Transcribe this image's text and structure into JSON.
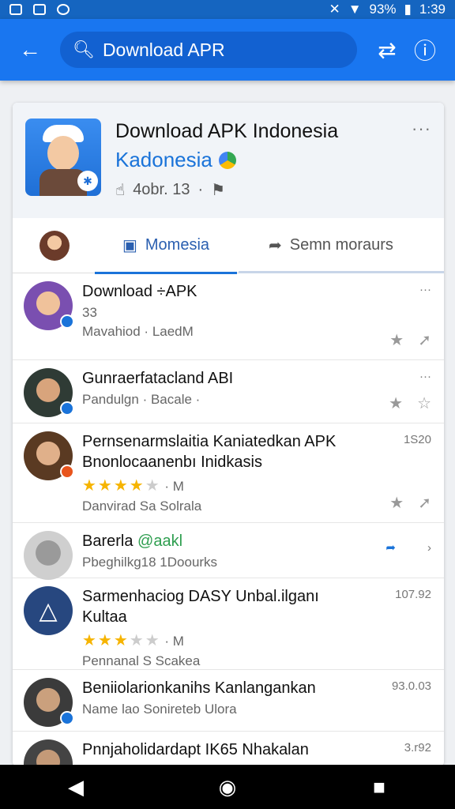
{
  "status": {
    "battery": "93%",
    "time": "1:39"
  },
  "appbar": {
    "search_text": "Download APR"
  },
  "header": {
    "title": "Download APK Indonesia",
    "subtitle": "Kadonesia",
    "meta": "4obr. 13"
  },
  "tabs": {
    "active": "Momesia",
    "other": "Semn moraurs"
  },
  "rows": [
    {
      "title": "Download ÷APK",
      "line1": "33",
      "line2": "Mavahiod · LaedM",
      "right": "···"
    },
    {
      "title": "Gunraerfatacland ABI",
      "line1": "Pandulgn · Bacale ·",
      "line2": "",
      "right": "···"
    },
    {
      "title": "Pernsenarmslaitia Kaniatedkan APK Bnonlocaanenbı Inidkasis",
      "rating": "M",
      "line2": "Danvirad Sa Solrala",
      "right": "1S20"
    },
    {
      "title": "Barerla",
      "title_accent": "@aakl",
      "line1": "Pbeghilkg18 1Doourks",
      "right": "›"
    },
    {
      "title": "Sarmenhaciog DASY Unbal.ilganı Kultaa",
      "rating": "M",
      "line2": "Pennanal S Scakea",
      "right": "107.92"
    },
    {
      "title": "Beniiolarionkanihs Kanlangankan",
      "line1": "Name lao Sonireteb Ulora",
      "right": "93.0.03"
    },
    {
      "title": "Pnnjaholidardapt IK65 Nhakalan",
      "right": "3.r92"
    }
  ]
}
